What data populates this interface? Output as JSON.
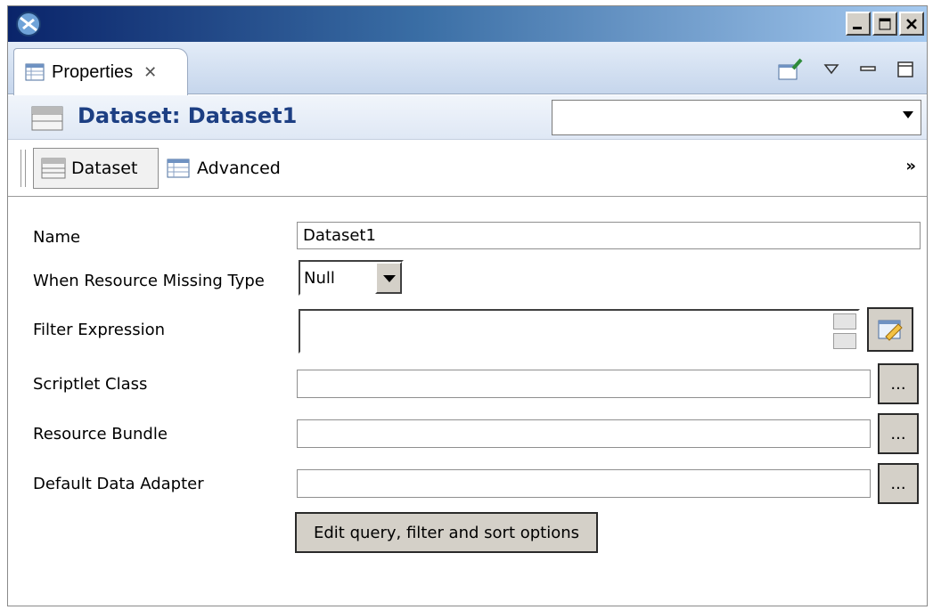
{
  "window": {
    "minimize_icon": "minimize-icon",
    "maximize_icon": "maximize-icon",
    "close_icon": "close-icon"
  },
  "tab": {
    "label": "Properties",
    "icon": "properties-table-icon"
  },
  "header": {
    "title": "Dataset: Dataset1",
    "combo_value": ""
  },
  "toolbar": {
    "dataset_label": "Dataset",
    "advanced_label": "Advanced",
    "more_label": "»"
  },
  "form": {
    "name_label": "Name",
    "name_value": "Dataset1",
    "resource_missing_label": "When Resource Missing Type",
    "resource_missing_value": "Null",
    "filter_label": "Filter Expression",
    "filter_value": "",
    "scriptlet_label": "Scriptlet Class",
    "scriptlet_value": "",
    "bundle_label": "Resource Bundle",
    "bundle_value": "",
    "adapter_label": "Default Data Adapter",
    "adapter_value": "",
    "browse_label": "...",
    "action_label": "Edit query, filter and sort options"
  }
}
